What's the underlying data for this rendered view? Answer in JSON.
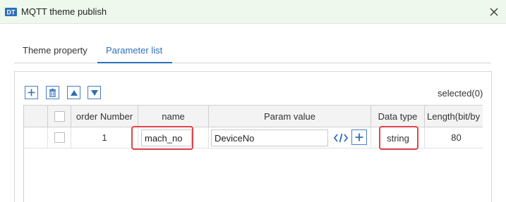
{
  "window": {
    "title": "MQTT theme publish",
    "accent": "#2d6fb8",
    "highlight": "#e0454a"
  },
  "tabs": [
    {
      "label": "Theme property",
      "active": false
    },
    {
      "label": "Parameter list",
      "active": true
    }
  ],
  "toolbar": {
    "selected_label": "selected(0)"
  },
  "table": {
    "columns": [
      "",
      "",
      "order Number",
      "name",
      "Param value",
      "Data type",
      "Length(bit/by"
    ],
    "rows": [
      {
        "order": "1",
        "name": "mach_no",
        "param_value": "DeviceNo",
        "data_type": "string",
        "length": "80"
      }
    ]
  }
}
